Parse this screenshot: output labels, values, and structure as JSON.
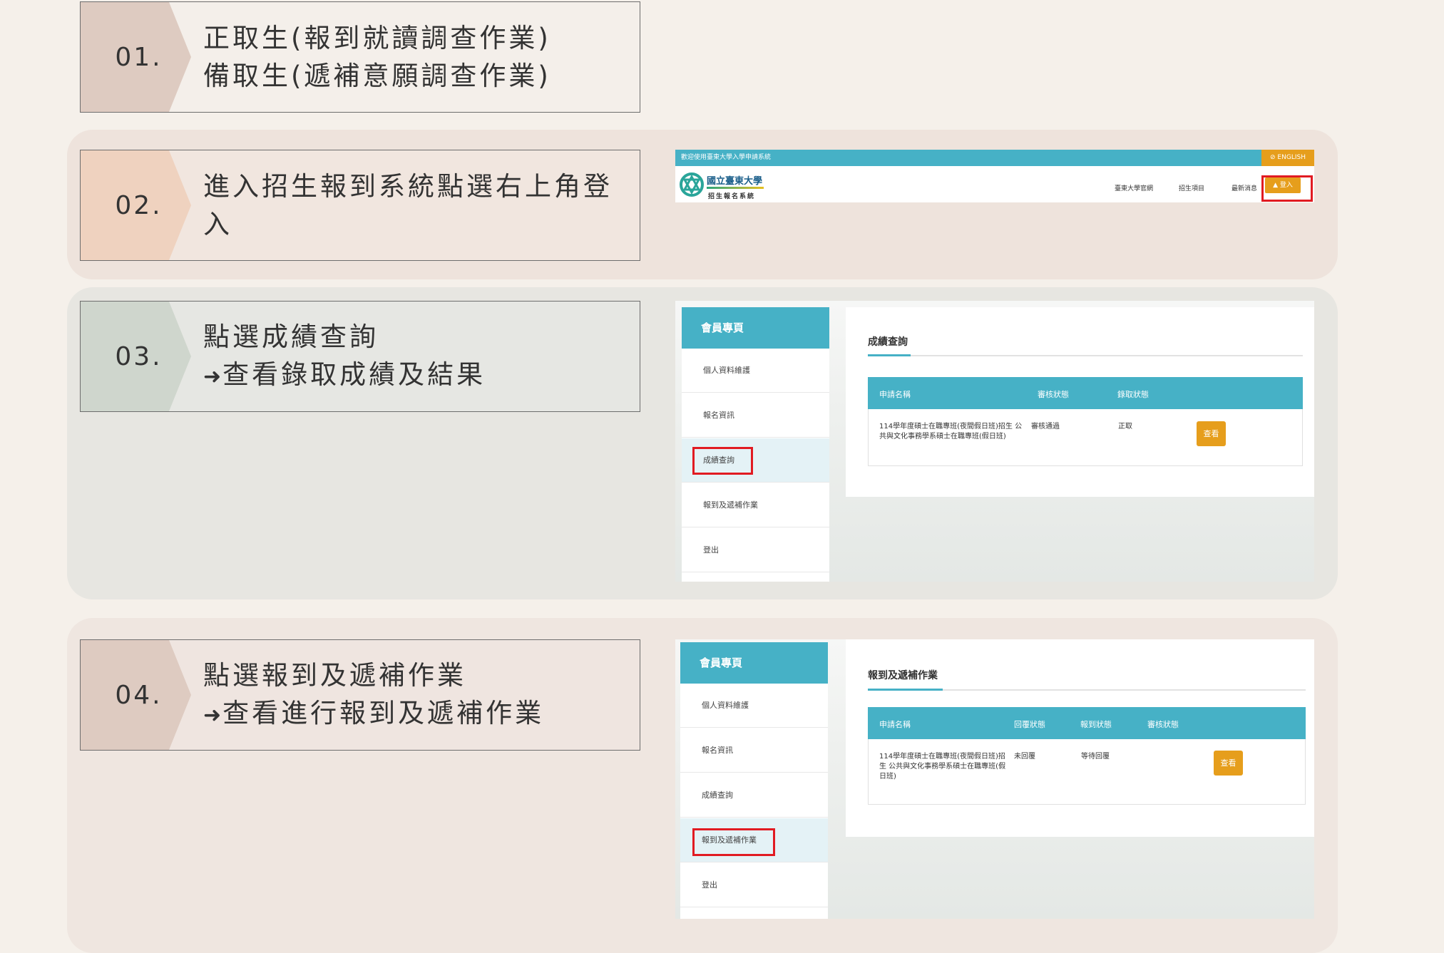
{
  "colors": {
    "page_bg": "#f5f0ea",
    "teal": "#46b1c6",
    "orange": "#e69e1c",
    "highlight": "#e11b22"
  },
  "steps": [
    {
      "num": "01.",
      "line1": "正取生(報到就讀調查作業)",
      "line2": "備取生(遞補意願調查作業)"
    },
    {
      "num": "02.",
      "line1": "進入招生報到系統點選右上角登入"
    },
    {
      "num": "03.",
      "line1": "點選成績查詢",
      "arrow": "➜",
      "line2": "查看錄取成績及結果"
    },
    {
      "num": "04.",
      "line1": "點選報到及遞補作業",
      "arrow": "➜",
      "line2": "查看進行報到及遞補作業"
    }
  ],
  "login_shot": {
    "welcome": "歡迎使用臺東大學入學申請系統",
    "english": "ENGLISH",
    "logo_name": "國立臺東大學",
    "logo_sub": "招生報名系統",
    "nav": [
      "臺東大學官網",
      "招生項目",
      "最新消息"
    ],
    "login": "登入"
  },
  "sidebar": {
    "title": "會員專頁",
    "items": [
      "個人資料維護",
      "報名資訊",
      "成績查詢",
      "報到及遞補作業",
      "登出"
    ]
  },
  "score_shot": {
    "title": "成績查詢",
    "headers": [
      "申請名稱",
      "審核狀態",
      "錄取狀態"
    ],
    "row": {
      "name": "114學年度碩士在職專班(夜間假日班)招生 公共與文化事務學系碩士在職專班(假日班)",
      "review": "審核通過",
      "admit": "正取",
      "button": "查看"
    }
  },
  "report_shot": {
    "title": "報到及遞補作業",
    "headers": [
      "申請名稱",
      "回覆狀態",
      "報到狀態",
      "審核狀態"
    ],
    "row": {
      "name": "114學年度碩士在職專班(夜間假日班)招生 公共與文化事務學系碩士在職專班(假日班)",
      "reply": "未回覆",
      "report": "等待回覆",
      "review": "",
      "button": "查看"
    }
  }
}
